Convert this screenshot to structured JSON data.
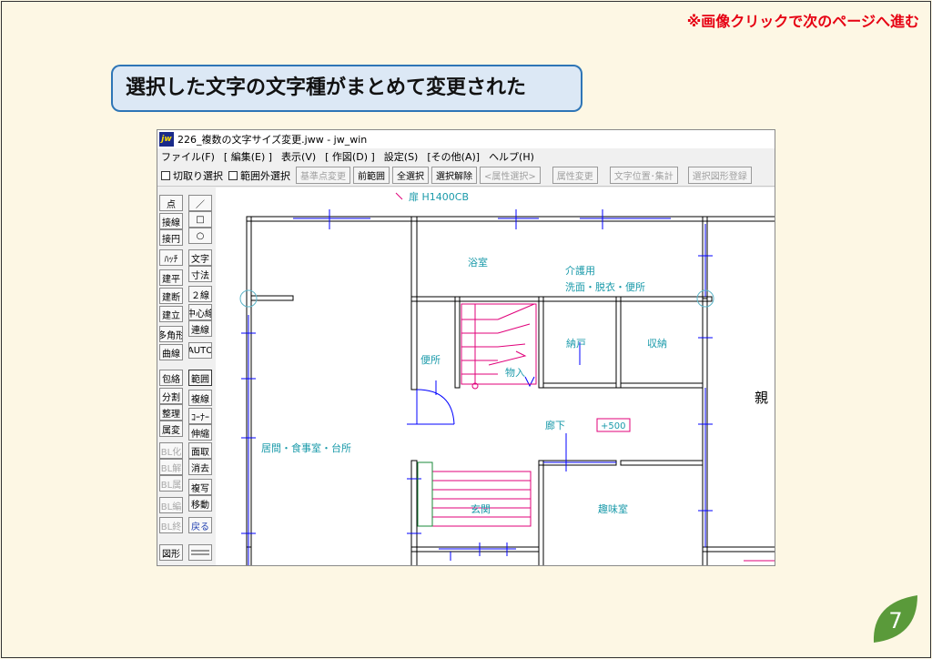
{
  "nav_note": "※画像クリックで次のページへ進む",
  "callout": "選択した文字の文字種がまとめて変更された",
  "page_number": "7",
  "app": {
    "icon_text": "jw",
    "title": "226_複数の文字サイズ変更.jww - jw_win",
    "menu": [
      "ファイル(F)",
      "[ 編集(E) ]",
      "表示(V)",
      "[ 作図(D) ]",
      "設定(S)",
      "[その他(A)]",
      "ヘルプ(H)"
    ],
    "toolbar": {
      "check1": "切取り選択",
      "check2": "範囲外選択",
      "btn_base": "基準点変更",
      "btn_prev": "前範囲",
      "btn_all": "全選択",
      "btn_clear": "選択解除",
      "btn_attr_sel": "<属性選択>",
      "btn_attr_change": "属性変更",
      "btn_text_pos": "文字位置･集計",
      "btn_register": "選択図形登録"
    },
    "left_col1": [
      "点",
      "接線",
      "接円",
      "ﾊｯﾁ",
      "建平",
      "建断",
      "建立",
      "多角形",
      "曲線",
      "包絡",
      "分割",
      "整理",
      "属変",
      "BL化",
      "BL解",
      "BL属",
      "BL編",
      "BL終",
      "図形"
    ],
    "left_col2": [
      "／",
      "□",
      "○",
      "文字",
      "寸法",
      "２線",
      "中心線",
      "連線",
      "AUTO",
      "範囲",
      "複線",
      "ｺｰﾅｰ",
      "伸縮",
      "面取",
      "消去",
      "複写",
      "移動",
      "戻る"
    ],
    "rooms": {
      "bath": "浴室",
      "care1": "介護用",
      "care2": "洗面・脱衣・便所",
      "storage": "納戸",
      "closet": "収納",
      "toilet": "便所",
      "things": "物入",
      "hall": "廊下",
      "level": "+500",
      "living": "居間・食事室・台所",
      "entrance": "玄関",
      "hobby": "趣味室",
      "parent": "親",
      "top_label": "扉 H1400CB"
    }
  }
}
